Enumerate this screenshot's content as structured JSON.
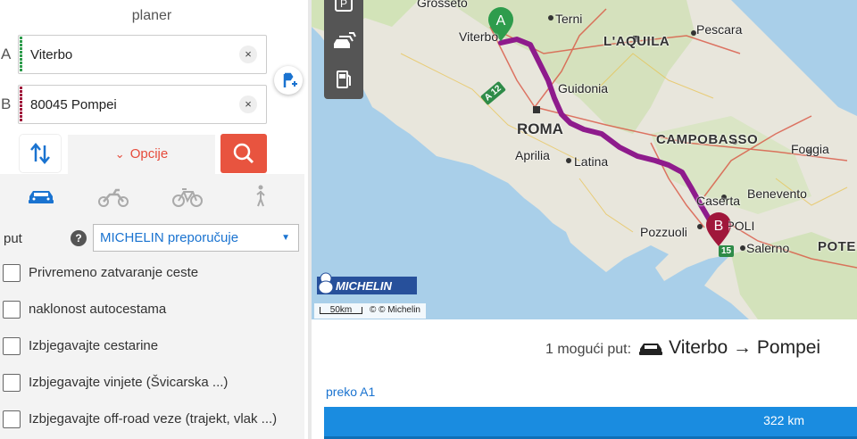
{
  "planner": {
    "title": "planer",
    "waypoint_a": {
      "letter": "A",
      "value": "Viterbo",
      "color": "#2e9c4c"
    },
    "waypoint_b": {
      "letter": "B",
      "value": "80045 Pompei",
      "color": "#a0173b"
    },
    "clear_icon": "×",
    "options_label": "Opcije",
    "modes": [
      "car-icon",
      "motorbike-icon",
      "bicycle-icon",
      "pedestrian-icon"
    ],
    "active_mode": "car",
    "route_type_label": "put",
    "help_icon": "?",
    "route_type_selected": "MICHELIN preporučuje",
    "options": [
      {
        "label": "Privremeno zatvaranje ceste",
        "checked": false
      },
      {
        "label": "naklonost autocestama",
        "checked": false
      },
      {
        "label": "Izbjegavajte cestarine",
        "checked": false
      },
      {
        "label": "Izbjegavajte vinjete (Švicarska ...)",
        "checked": false
      },
      {
        "label": "Izbjegavajte off-road veze (trajekt, vlak ...)",
        "checked": false
      }
    ]
  },
  "map": {
    "places": {
      "grosseto": "Grosseto",
      "viterbo": "Viterbo",
      "terni": "Terni",
      "laquila": "L'AQUILA",
      "pescara": "Pescara",
      "guidonia": "Guidonia",
      "roma": "ROMA",
      "aprilia": "Aprilia",
      "latina": "Latina",
      "campobasso": "CAMPOBASSO",
      "foggia": "Foggia",
      "caserta": "Caserta",
      "benevento": "Benevento",
      "napoli": "NAPOLI",
      "pozzuoli": "Pozzuoli",
      "salerno": "Salerno",
      "potenza": "POTE"
    },
    "marker_a": "A",
    "marker_b": "B",
    "motorway_a12": "A 12",
    "motorway_a15": "15",
    "brand": "MICHELIN",
    "scale_label": "50km",
    "copyright": "© © Michelin",
    "toolbar_icons": [
      "parking-icon",
      "traffic-icon",
      "fuel-station-icon"
    ],
    "route_color": "#8e1b8c"
  },
  "results": {
    "count_text": "1 mogući put:",
    "route_text": "Viterbo → Pompei",
    "via": "preko A1",
    "distance": "322 km",
    "bar_color": "#1a8ce0"
  }
}
